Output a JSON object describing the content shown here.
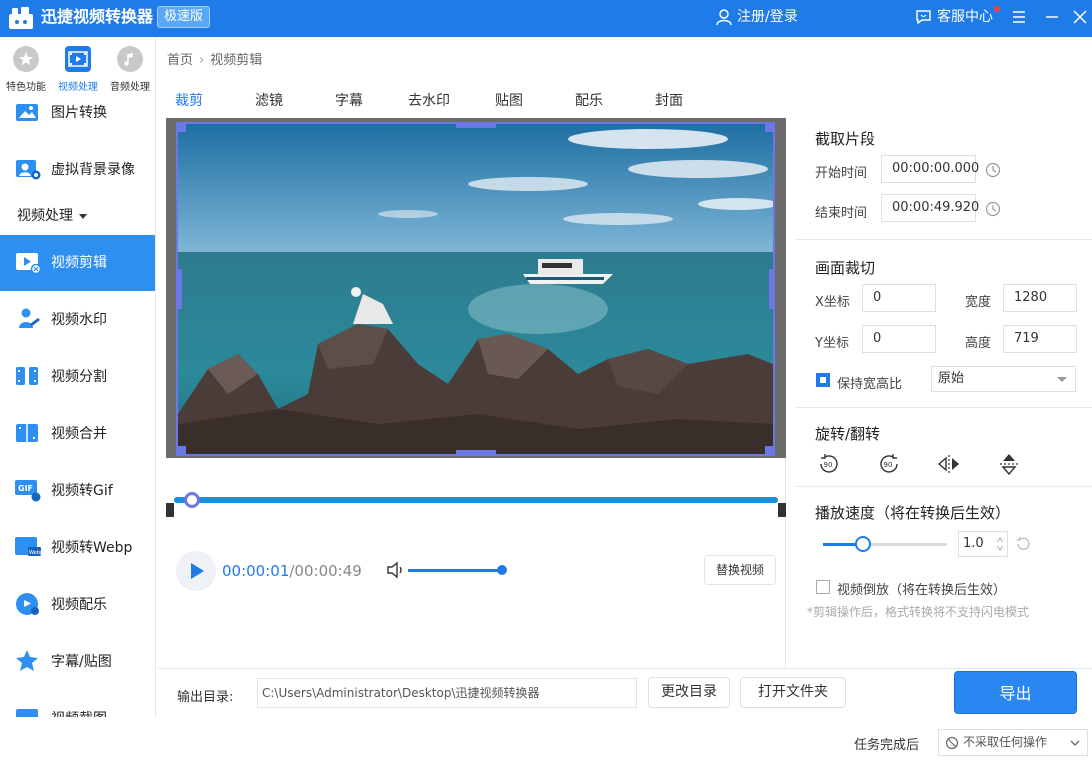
{
  "app": {
    "title": "迅捷视频转换器",
    "edition": "极速版",
    "login": "注册/登录",
    "service": "客服中心"
  },
  "sidebar": {
    "categories": [
      {
        "label": "特色功能",
        "icon": "star-icon"
      },
      {
        "label": "视频处理",
        "icon": "film-icon"
      },
      {
        "label": "音频处理",
        "icon": "music-icon"
      }
    ],
    "items_top": [
      {
        "label": "图片转换",
        "icon": "image-convert-icon"
      },
      {
        "label": "虚拟背景录像",
        "icon": "virtual-bg-icon"
      }
    ],
    "group_label": "视频处理",
    "items": [
      {
        "label": "视频剪辑",
        "icon": "video-edit-icon"
      },
      {
        "label": "视频水印",
        "icon": "watermark-icon"
      },
      {
        "label": "视频分割",
        "icon": "split-icon"
      },
      {
        "label": "视频合并",
        "icon": "merge-icon"
      },
      {
        "label": "视频转Gif",
        "icon": "gif-icon"
      },
      {
        "label": "视频转Webp",
        "icon": "webp-icon"
      },
      {
        "label": "视频配乐",
        "icon": "music-note-icon"
      },
      {
        "label": "字幕/贴图",
        "icon": "sticker-icon"
      },
      {
        "label": "视频截图",
        "icon": "screenshot-icon"
      }
    ]
  },
  "breadcrumb": {
    "home": "首页",
    "sep": "›",
    "current": "视频剪辑"
  },
  "tools": {
    "tabs": [
      "裁剪",
      "滤镜",
      "字幕",
      "去水印",
      "贴图",
      "配乐",
      "封面"
    ]
  },
  "player": {
    "current": "00:00:01",
    "total": "/00:00:49",
    "replace": "替换视频",
    "progress": 0.02,
    "volume": 1.0
  },
  "panel": {
    "clip_title": "截取片段",
    "start_label": "开始时间",
    "start_value": "00:00:00.000",
    "end_label": "结束时间",
    "end_value": "00:00:49.920",
    "crop_title": "画面裁切",
    "x_label": "X坐标",
    "x_value": "0",
    "width_label": "宽度",
    "width_value": "1280",
    "y_label": "Y坐标",
    "y_value": "0",
    "height_label": "高度",
    "height_value": "719",
    "keep_ratio_label": "保持宽高比",
    "keep_ratio_checked": true,
    "ratio_option": "原始",
    "rotate_title": "旋转/翻转",
    "rotate_ccw": "90",
    "rotate_cw": "90",
    "speed_title": "播放速度（将在转换后生效）",
    "speed_value": "1.0",
    "reverse_label": "视频倒放（将在转换后生效）",
    "reverse_checked": false,
    "hint": "*剪辑操作后，格式转换将不支持闪电模式"
  },
  "output": {
    "label": "输出目录:",
    "path": "C:\\Users\\Administrator\\Desktop\\迅捷视频转换器",
    "change_dir": "更改目录",
    "open_folder": "打开文件夹",
    "export": "导出"
  },
  "status": {
    "after_label": "任务完成后",
    "after_option": "不采取任何操作"
  },
  "colors": {
    "primary": "#1f7be8",
    "sidebar_active": "#2d8ff0",
    "crop_frame": "#6c78e8"
  }
}
